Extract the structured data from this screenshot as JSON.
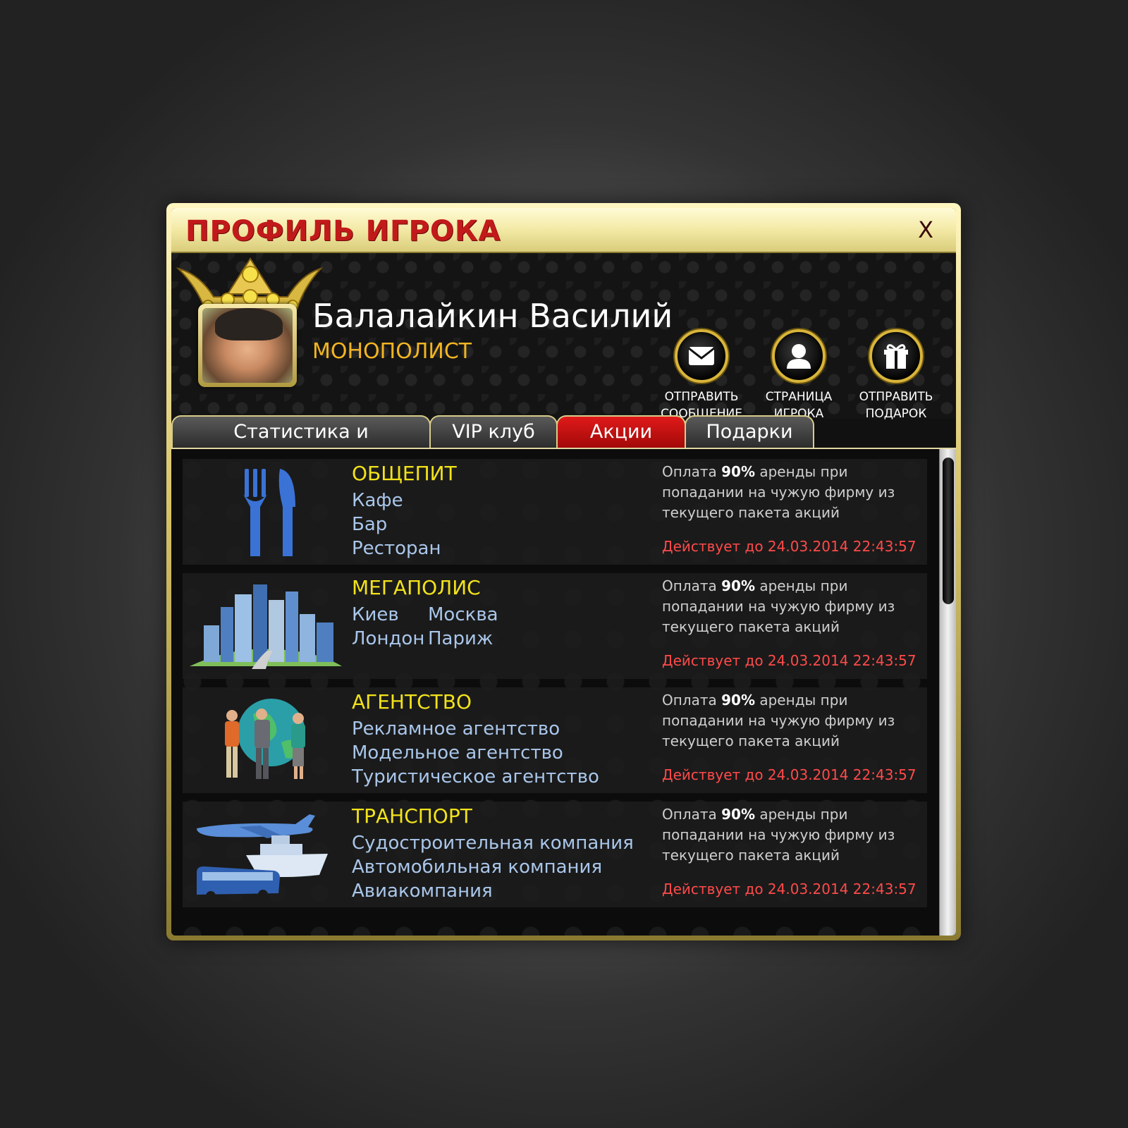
{
  "window": {
    "title": "ПРОФИЛЬ ИГРОКА",
    "close_label": "X"
  },
  "player": {
    "name": "Балалайкин Василий",
    "rank": "МОНОПОЛИСТ"
  },
  "actions": [
    {
      "line1": "ОТПРАВИТЬ",
      "line2": "СООБЩЕНИЕ",
      "icon": "envelope-icon"
    },
    {
      "line1": "СТРАНИЦА",
      "line2": "ИГРОКА",
      "icon": "user-icon"
    },
    {
      "line1": "ОТПРАВИТЬ",
      "line2": "ПОДАРОК",
      "icon": "gift-icon"
    }
  ],
  "tabs": [
    {
      "label": "Статистика и Достижения",
      "active": false
    },
    {
      "label": "VIP клуб",
      "active": false
    },
    {
      "label": "Акции",
      "active": true
    },
    {
      "label": "Подарки",
      "active": false
    }
  ],
  "promo_text": {
    "prefix": "Оплата ",
    "percent": "90%",
    "suffix": " аренды при попадании на чужую фирму из текущего пакета акций",
    "expiry": "Действует до 24.03.2014 22:43:57"
  },
  "rows": [
    {
      "title": "ОБЩЕПИТ",
      "icon": "fork-knife-icon",
      "items": [
        "Кафе",
        "Бар",
        "Ресторан"
      ]
    },
    {
      "title": "МЕГАПОЛИС",
      "icon": "city-icon",
      "items": [
        "Киев",
        "Москва",
        "Лондон",
        "Париж"
      ]
    },
    {
      "title": "АГЕНТСТВО",
      "icon": "people-globe-icon",
      "items": [
        "Рекламное агентство",
        "Модельное агентство",
        "Туристическое агентство"
      ]
    },
    {
      "title": "ТРАНСПОРТ",
      "icon": "transport-icon",
      "items": [
        "Судостроительная компания",
        "Автомобильная компания",
        "Авиакомпания"
      ]
    }
  ],
  "colors": {
    "accent_red": "#c21a1a",
    "rank_gold": "#f2b521",
    "section_yellow": "#f2e21a",
    "item_blue": "#a9c6ea",
    "expiry_red": "#ff4a4a"
  }
}
